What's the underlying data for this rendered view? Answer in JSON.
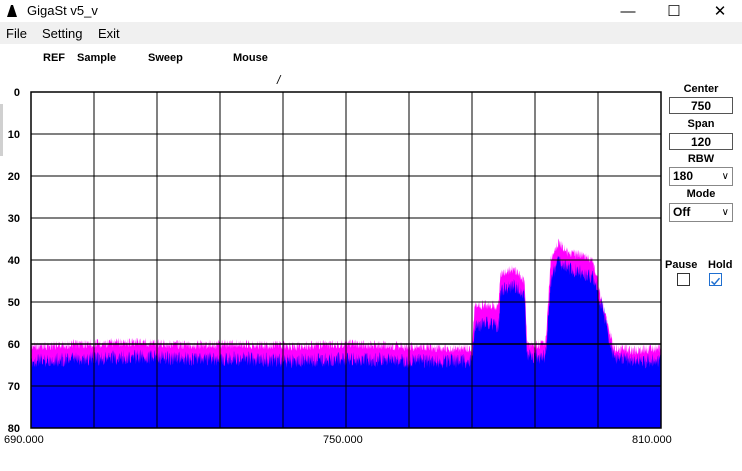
{
  "window": {
    "title": "GigaSt v5_v",
    "minimize_glyph": "—",
    "maximize_glyph": "☐",
    "close_glyph": "✕"
  },
  "menu": [
    {
      "label": "File"
    },
    {
      "label": "Setting"
    },
    {
      "label": "Exit"
    }
  ],
  "status": {
    "ref_label": "REF",
    "sample_label": "Sample",
    "sweep_label": "Sweep",
    "mouse_label": "Mouse",
    "mouse_value": "/"
  },
  "controls": {
    "center_label": "Center",
    "center_value": "750",
    "span_label": "Span",
    "span_value": "120",
    "rbw_label": "RBW",
    "rbw_value": "180",
    "mode_label": "Mode",
    "mode_value": "Off",
    "pause_label": "Pause",
    "pause_checked": false,
    "hold_label": "Hold",
    "hold_checked": true
  },
  "chart_data": {
    "type": "area",
    "x_tick_labels": [
      "690.000",
      "750.000",
      "810.000"
    ],
    "y_tick_labels": [
      "0",
      "10",
      "20",
      "30",
      "40",
      "50",
      "60",
      "70",
      "80"
    ],
    "xlim": [
      690,
      810
    ],
    "ylim": [
      0,
      80
    ],
    "y_inverted": true,
    "grid": true,
    "x_divisions": 10,
    "y_divisions": 8,
    "reference_level": 60,
    "colors": {
      "live": "#0000ff",
      "hold": "#ff00ff",
      "grid": "#000000",
      "reference": "#000000"
    },
    "series": [
      {
        "type": "hold-peak",
        "x": [
          690,
          700,
          710,
          720,
          730,
          740,
          750,
          760,
          770,
          774,
          774.5,
          777,
          779,
          779.5,
          782,
          784,
          784.5,
          788,
          789,
          790,
          790.5,
          792,
          795,
          797,
          799,
          800,
          801,
          805,
          810
        ],
        "y": [
          60.5,
          60,
          59.5,
          60.2,
          60,
          60.5,
          60,
          60.5,
          61,
          61,
          51,
          50.5,
          51,
          43,
          42,
          45,
          60,
          60,
          40,
          37,
          36,
          38,
          39,
          40,
          51,
          56,
          61,
          61.5,
          61
        ]
      },
      {
        "type": "live",
        "x": [
          690,
          700,
          710,
          720,
          730,
          740,
          750,
          760,
          770,
          774,
          774.5,
          777,
          779,
          779.5,
          782,
          784,
          784.5,
          788,
          789,
          790,
          790.5,
          792,
          795,
          797,
          799,
          800,
          801,
          805,
          810
        ],
        "y": [
          64,
          63.5,
          63,
          63.5,
          63.5,
          64,
          63.5,
          64,
          64,
          64,
          56,
          55,
          56,
          47,
          46,
          48,
          63,
          63,
          45,
          41,
          40,
          42,
          43,
          44,
          52,
          58,
          63,
          64,
          64
        ]
      }
    ]
  }
}
